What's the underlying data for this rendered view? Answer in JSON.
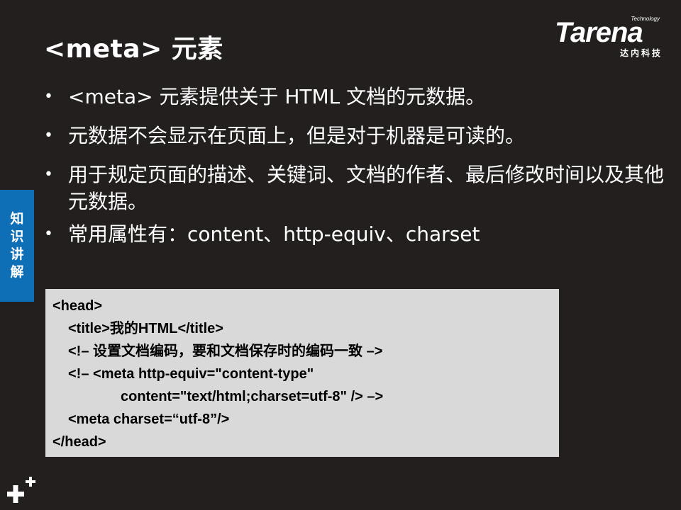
{
  "title": "<meta> 元素",
  "logo": {
    "brand": "Tarena",
    "tagline": "Technology",
    "subtitle": "达内科技"
  },
  "bullets": [
    "<meta> 元素提供关于 HTML 文档的元数据。",
    "元数据不会显示在页面上，但是对于机器是可读的。",
    "用于规定页面的描述、关键词、文档的作者、最后修改时间以及其他元数据。",
    "常用属性有：content、http-equiv、charset"
  ],
  "bullet_symbol": "•",
  "side_tab": [
    "知",
    "识",
    "讲",
    "解"
  ],
  "code_lines": [
    "<head>",
    "<title>我的HTML</title>",
    "<!– 设置文档编码，要和文档保存时的编码一致 –>",
    "<!– <meta http-equiv=\"content-type\"",
    "content=\"text/html;charset=utf-8\" /> –>",
    "<meta charset=“utf-8”/>",
    "</head>"
  ],
  "colors": {
    "background": "#231f1f",
    "side_tab": "#0f6fb6",
    "code_box": "#d9d9d9"
  },
  "icons": [
    "plus-plus-icon"
  ]
}
